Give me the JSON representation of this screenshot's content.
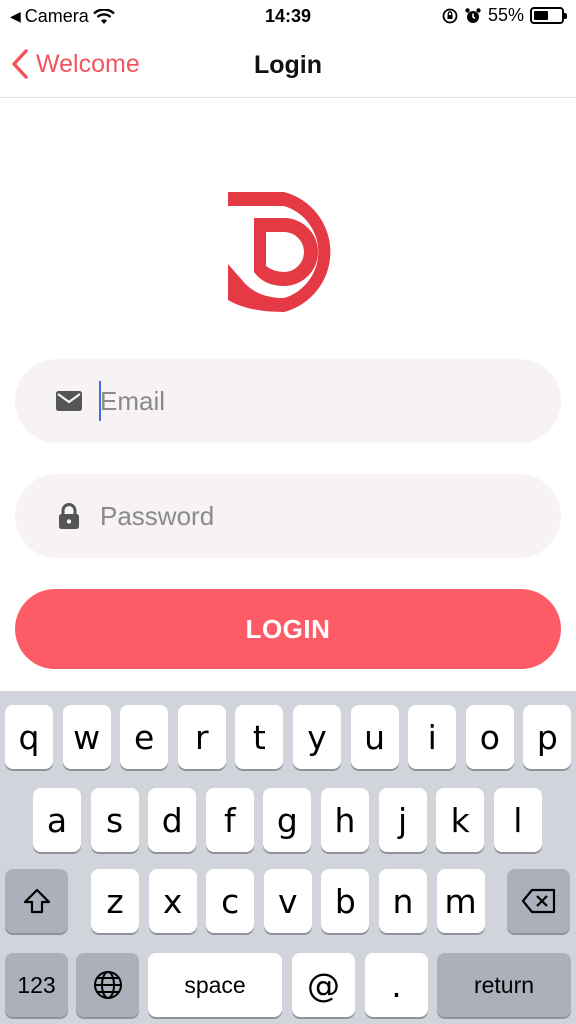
{
  "status_bar": {
    "back_app": "Camera",
    "time": "14:39",
    "battery_percent": "55%",
    "battery_level": 0.55
  },
  "nav": {
    "back_label": "Welcome",
    "title": "Login"
  },
  "colors": {
    "brand": "#e63946",
    "accent": "#fd5b66",
    "back_link": "#f2555e",
    "field_bg": "#f6f3f2",
    "keyboard_bg": "#d1d4da"
  },
  "form": {
    "email_placeholder": "Email",
    "email_value": "",
    "email_icon": "mail-icon",
    "password_placeholder": "Password",
    "password_value": "",
    "password_icon": "lock-icon",
    "login_label": "LOGIN"
  },
  "keyboard": {
    "row1": [
      "q",
      "w",
      "e",
      "r",
      "t",
      "y",
      "u",
      "i",
      "o",
      "p"
    ],
    "row2": [
      "a",
      "s",
      "d",
      "f",
      "g",
      "h",
      "j",
      "k",
      "l"
    ],
    "row3": [
      "z",
      "x",
      "c",
      "v",
      "b",
      "n",
      "m"
    ],
    "shift_icon": "shift-icon",
    "delete_icon": "backspace-icon",
    "numbers_label": "123",
    "globe_icon": "globe-icon",
    "space_label": "space",
    "at_label": "@",
    "dot_label": ".",
    "return_label": "return"
  }
}
